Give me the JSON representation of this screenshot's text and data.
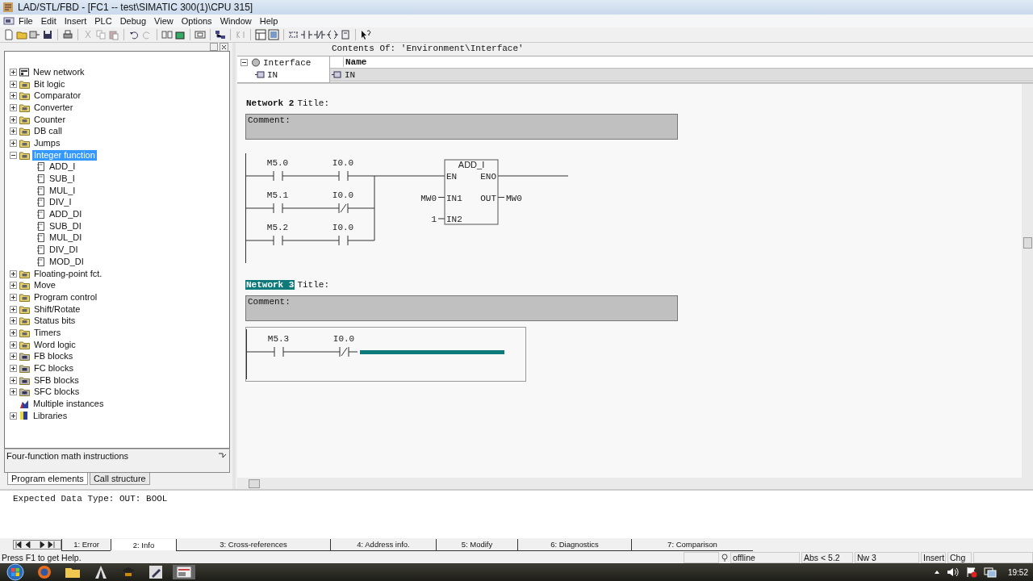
{
  "window": {
    "title": "LAD/STL/FBD  - [FC1 -- test\\SIMATIC 300(1)\\CPU 315]"
  },
  "menu": [
    "File",
    "Edit",
    "Insert",
    "PLC",
    "Debug",
    "View",
    "Options",
    "Window",
    "Help"
  ],
  "program_elements": {
    "tree": [
      {
        "label": "New network",
        "kind": "action",
        "expanded": false,
        "selected": false
      },
      {
        "label": "Bit logic",
        "kind": "folder",
        "expanded": false,
        "selected": false
      },
      {
        "label": "Comparator",
        "kind": "folder",
        "expanded": false,
        "selected": false
      },
      {
        "label": "Converter",
        "kind": "folder",
        "expanded": false,
        "selected": false
      },
      {
        "label": "Counter",
        "kind": "folder",
        "expanded": false,
        "selected": false
      },
      {
        "label": "DB call",
        "kind": "folder",
        "expanded": false,
        "selected": false
      },
      {
        "label": "Jumps",
        "kind": "folder",
        "expanded": false,
        "selected": false
      },
      {
        "label": "Integer function",
        "kind": "folder",
        "expanded": true,
        "selected": true,
        "children": [
          {
            "label": "ADD_I",
            "kind": "block",
            "selected": false
          },
          {
            "label": "SUB_I",
            "kind": "block",
            "selected": false
          },
          {
            "label": "MUL_I",
            "kind": "block",
            "selected": false
          },
          {
            "label": "DIV_I",
            "kind": "block",
            "selected": false
          },
          {
            "label": "ADD_DI",
            "kind": "block",
            "selected": false
          },
          {
            "label": "SUB_DI",
            "kind": "block",
            "selected": false
          },
          {
            "label": "MUL_DI",
            "kind": "block",
            "selected": false
          },
          {
            "label": "DIV_DI",
            "kind": "block",
            "selected": false
          },
          {
            "label": "MOD_DI",
            "kind": "block",
            "selected": false
          }
        ]
      },
      {
        "label": "Floating-point fct.",
        "kind": "folder",
        "expanded": false,
        "selected": false
      },
      {
        "label": "Move",
        "kind": "folder",
        "expanded": false,
        "selected": false
      },
      {
        "label": "Program control",
        "kind": "folder",
        "expanded": false,
        "selected": false
      },
      {
        "label": "Shift/Rotate",
        "kind": "folder",
        "expanded": false,
        "selected": false
      },
      {
        "label": "Status bits",
        "kind": "folder",
        "expanded": false,
        "selected": false
      },
      {
        "label": "Timers",
        "kind": "folder",
        "expanded": false,
        "selected": false
      },
      {
        "label": "Word logic",
        "kind": "folder",
        "expanded": false,
        "selected": false
      },
      {
        "label": "FB blocks",
        "kind": "blocks",
        "expanded": false,
        "selected": false
      },
      {
        "label": "FC blocks",
        "kind": "blocks",
        "expanded": false,
        "selected": false
      },
      {
        "label": "SFB blocks",
        "kind": "blocks",
        "expanded": false,
        "selected": false
      },
      {
        "label": "SFC blocks",
        "kind": "blocks",
        "expanded": false,
        "selected": false
      },
      {
        "label": "Multiple instances",
        "kind": "instances",
        "selected": false
      },
      {
        "label": "Libraries",
        "kind": "library",
        "expanded": false,
        "selected": false
      }
    ],
    "description": "Four-function math instructions",
    "tabs": [
      {
        "label": "Program elements",
        "selected": true
      },
      {
        "label": "Call structure",
        "selected": false
      }
    ]
  },
  "interface": {
    "heading": "Contents Of: 'Environment\\Interface'",
    "tree_root": "Interface",
    "tree_child": "IN",
    "column": "Name",
    "row": "IN"
  },
  "networks": [
    {
      "label": "Network 2",
      "title": "Title:",
      "selected": false,
      "comment": "Comment:",
      "rungs": [
        [
          {
            "address": "M5.0",
            "kind": "no"
          },
          {
            "address": "I0.0",
            "kind": "no"
          }
        ],
        [
          {
            "address": "M5.1",
            "kind": "no"
          },
          {
            "address": "I0.0",
            "kind": "nc"
          }
        ],
        [
          {
            "address": "M5.2",
            "kind": "no"
          },
          {
            "address": "I0.0",
            "kind": "no"
          }
        ]
      ],
      "box": {
        "name": "ADD_I",
        "inputs": [
          {
            "pin": "EN"
          },
          {
            "pin": "IN1",
            "operand": "MW0"
          },
          {
            "pin": "IN2",
            "operand": "1"
          }
        ],
        "outputs": [
          {
            "pin": "ENO"
          },
          {
            "pin": "OUT",
            "operand": "MW0"
          }
        ]
      }
    },
    {
      "label": "Network 3",
      "title": "Title:",
      "selected": true,
      "comment": "Comment:",
      "cursor": true,
      "rungs": [
        [
          {
            "address": "M5.3",
            "kind": "no"
          },
          {
            "address": "I0.0",
            "kind": "nc"
          }
        ]
      ]
    }
  ],
  "output": {
    "message": "Expected Data Type: OUT: BOOL",
    "tabs": [
      {
        "label": "1: Error",
        "selected": false
      },
      {
        "label": "2: Info",
        "selected": true
      },
      {
        "label": "3: Cross-references",
        "selected": false
      },
      {
        "label": "4: Address info.",
        "selected": false
      },
      {
        "label": "5: Modify",
        "selected": false
      },
      {
        "label": "6: Diagnostics",
        "selected": false
      },
      {
        "label": "7: Comparison",
        "selected": false
      }
    ]
  },
  "status_bar": {
    "help": "Press F1 to get Help.",
    "mode": "offline",
    "position": "Abs < 5.2",
    "network": "Nw 3",
    "insert": "Insert",
    "changed": "Chg"
  },
  "taskbar": {
    "time": "19:52"
  }
}
